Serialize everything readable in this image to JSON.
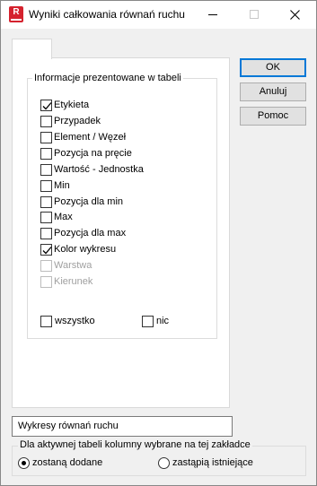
{
  "window": {
    "title": "Wyniki całkowania równań ruchu",
    "icon_letter": "R"
  },
  "group": {
    "legend": "Informacje prezentowane w tabeli",
    "items": [
      {
        "label": "Etykieta",
        "checked": true,
        "enabled": true
      },
      {
        "label": "Przypadek",
        "checked": false,
        "enabled": true
      },
      {
        "label": "Element / Węzeł",
        "checked": false,
        "enabled": true
      },
      {
        "label": "Pozycja na pręcie",
        "checked": false,
        "enabled": true
      },
      {
        "label": "Wartość - Jednostka",
        "checked": false,
        "enabled": true
      },
      {
        "label": "Min",
        "checked": false,
        "enabled": true
      },
      {
        "label": "Pozycja dla min",
        "checked": false,
        "enabled": true
      },
      {
        "label": "Max",
        "checked": false,
        "enabled": true
      },
      {
        "label": "Pozycja dla max",
        "checked": false,
        "enabled": true
      },
      {
        "label": "Kolor wykresu",
        "checked": true,
        "enabled": true
      },
      {
        "label": "Warstwa",
        "checked": false,
        "enabled": false
      },
      {
        "label": "Kierunek",
        "checked": false,
        "enabled": false
      }
    ],
    "all_label": "wszystko",
    "none_label": "nic"
  },
  "buttons": {
    "ok": "OK",
    "cancel": "Anuluj",
    "help": "Pomoc"
  },
  "table_name": "Wykresy równań ruchu",
  "columns_group": {
    "legend": "Dla aktywnej tabeli kolumny wybrane na tej zakładce",
    "option_add": "zostaną dodane",
    "option_replace": "zastąpią istniejące",
    "selected": "add"
  }
}
